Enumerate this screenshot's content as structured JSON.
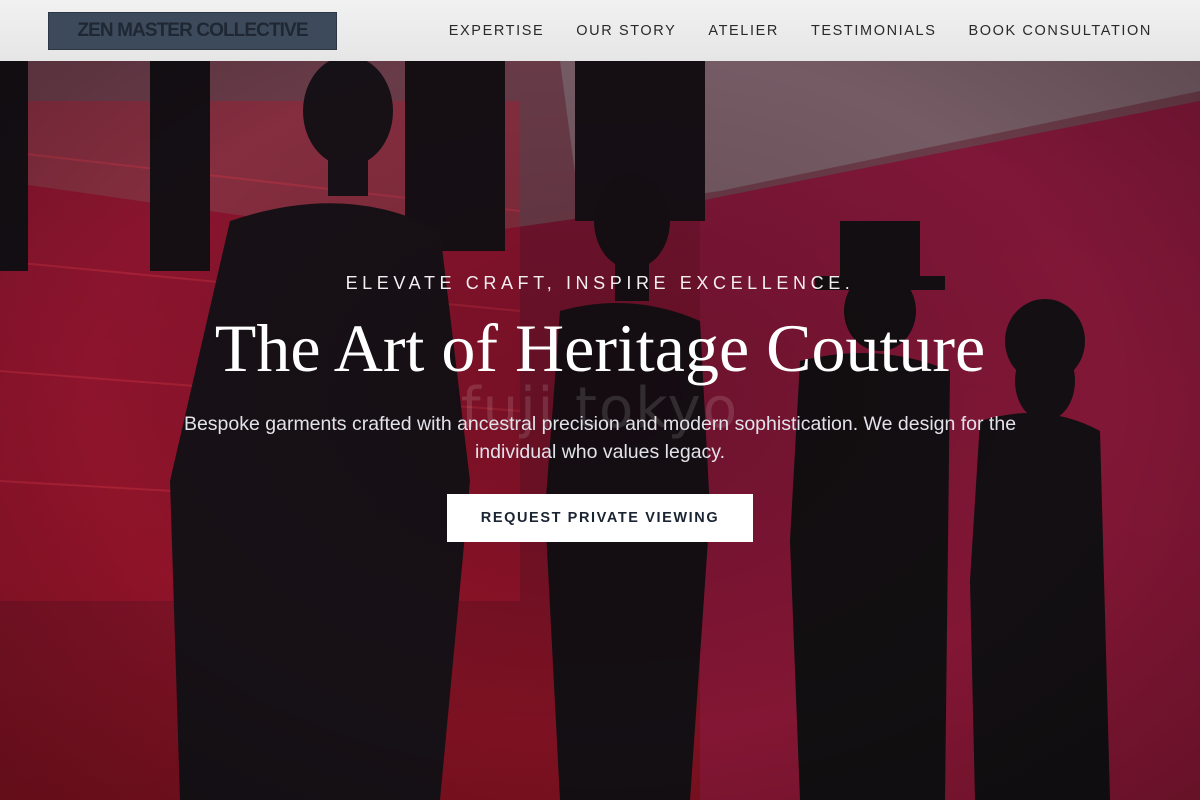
{
  "header": {
    "logo": "ZEN MASTER COLLECTIVE",
    "nav": [
      "EXPERTISE",
      "OUR STORY",
      "ATELIER",
      "TESTIMONIALS",
      "BOOK CONSULTATION"
    ]
  },
  "hero": {
    "eyebrow": "ELEVATE CRAFT, INSPIRE EXCELLENCE.",
    "title": "The Art of Heritage Couture",
    "subtitle": "Bespoke garments crafted with ancestral precision and modern sophistication. We design for the individual who values legacy.",
    "cta_label": "REQUEST PRIVATE VIEWING",
    "watermark": "fuji tokyo",
    "background": "photo of black-clad mannequins in a crimson gallery"
  },
  "colors": {
    "header_bg": "#ececec",
    "logo_bg": "#3d4a5b",
    "hero_red": "#a01a3a",
    "cta_bg": "#ffffff",
    "cta_text": "#1b2433"
  }
}
